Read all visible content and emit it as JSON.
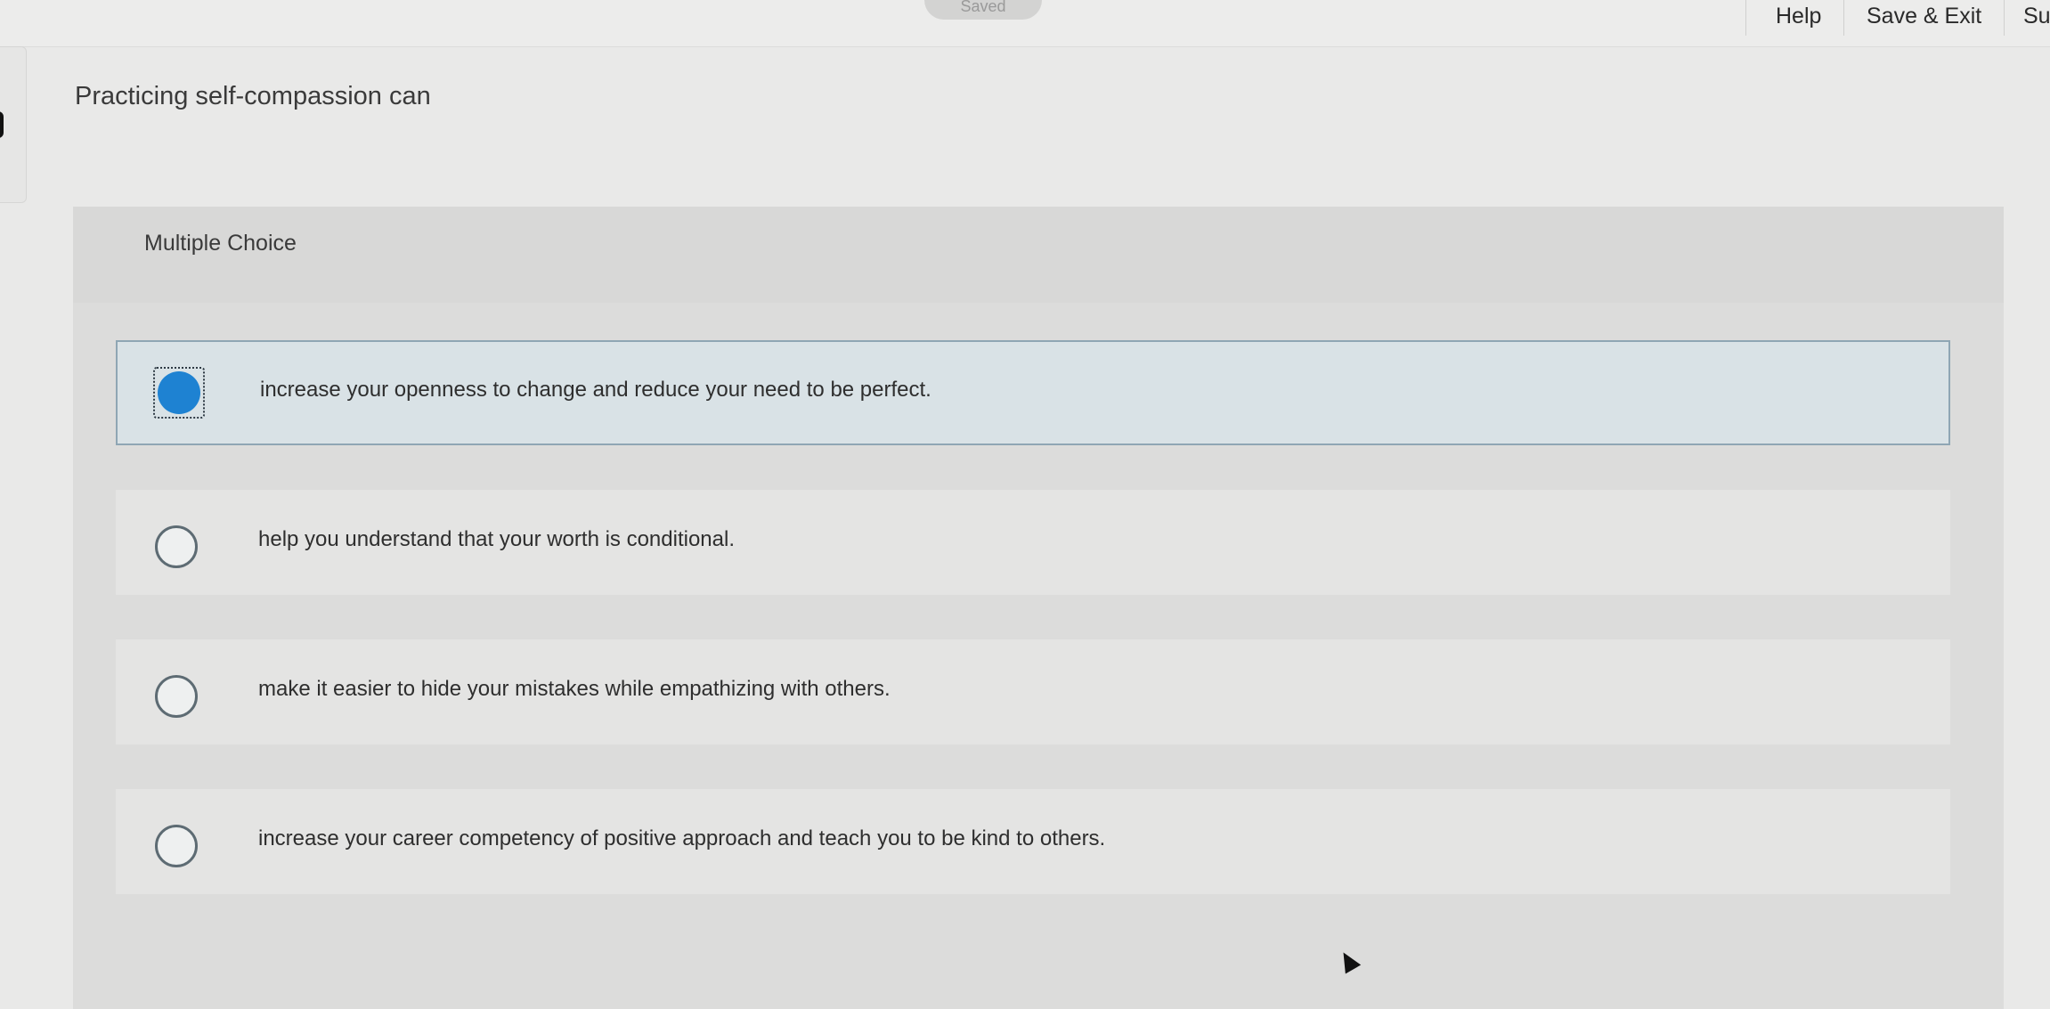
{
  "topbar": {
    "saved_label": "Saved",
    "help_label": "Help",
    "save_exit_label": "Save & Exit",
    "submit_label_partial": "Su"
  },
  "question": {
    "prompt": "Practicing self-compassion can",
    "type_label": "Multiple Choice"
  },
  "options": [
    {
      "text": "increase your openness to change and reduce your need to be perfect.",
      "selected": true
    },
    {
      "text": "help you understand that your worth is conditional.",
      "selected": false
    },
    {
      "text": "make it easier to hide your mistakes while empathizing with others.",
      "selected": false
    },
    {
      "text": "increase your career competency of positive approach and teach you to be kind to others.",
      "selected": false
    }
  ],
  "colors": {
    "selected_radio": "#1e82d2",
    "selected_background": "#d9e2e6"
  },
  "icons": {
    "cursor": "mouse-pointer-icon",
    "radio_selected": "radio-checked-icon",
    "radio_unselected": "radio-unchecked-icon"
  }
}
